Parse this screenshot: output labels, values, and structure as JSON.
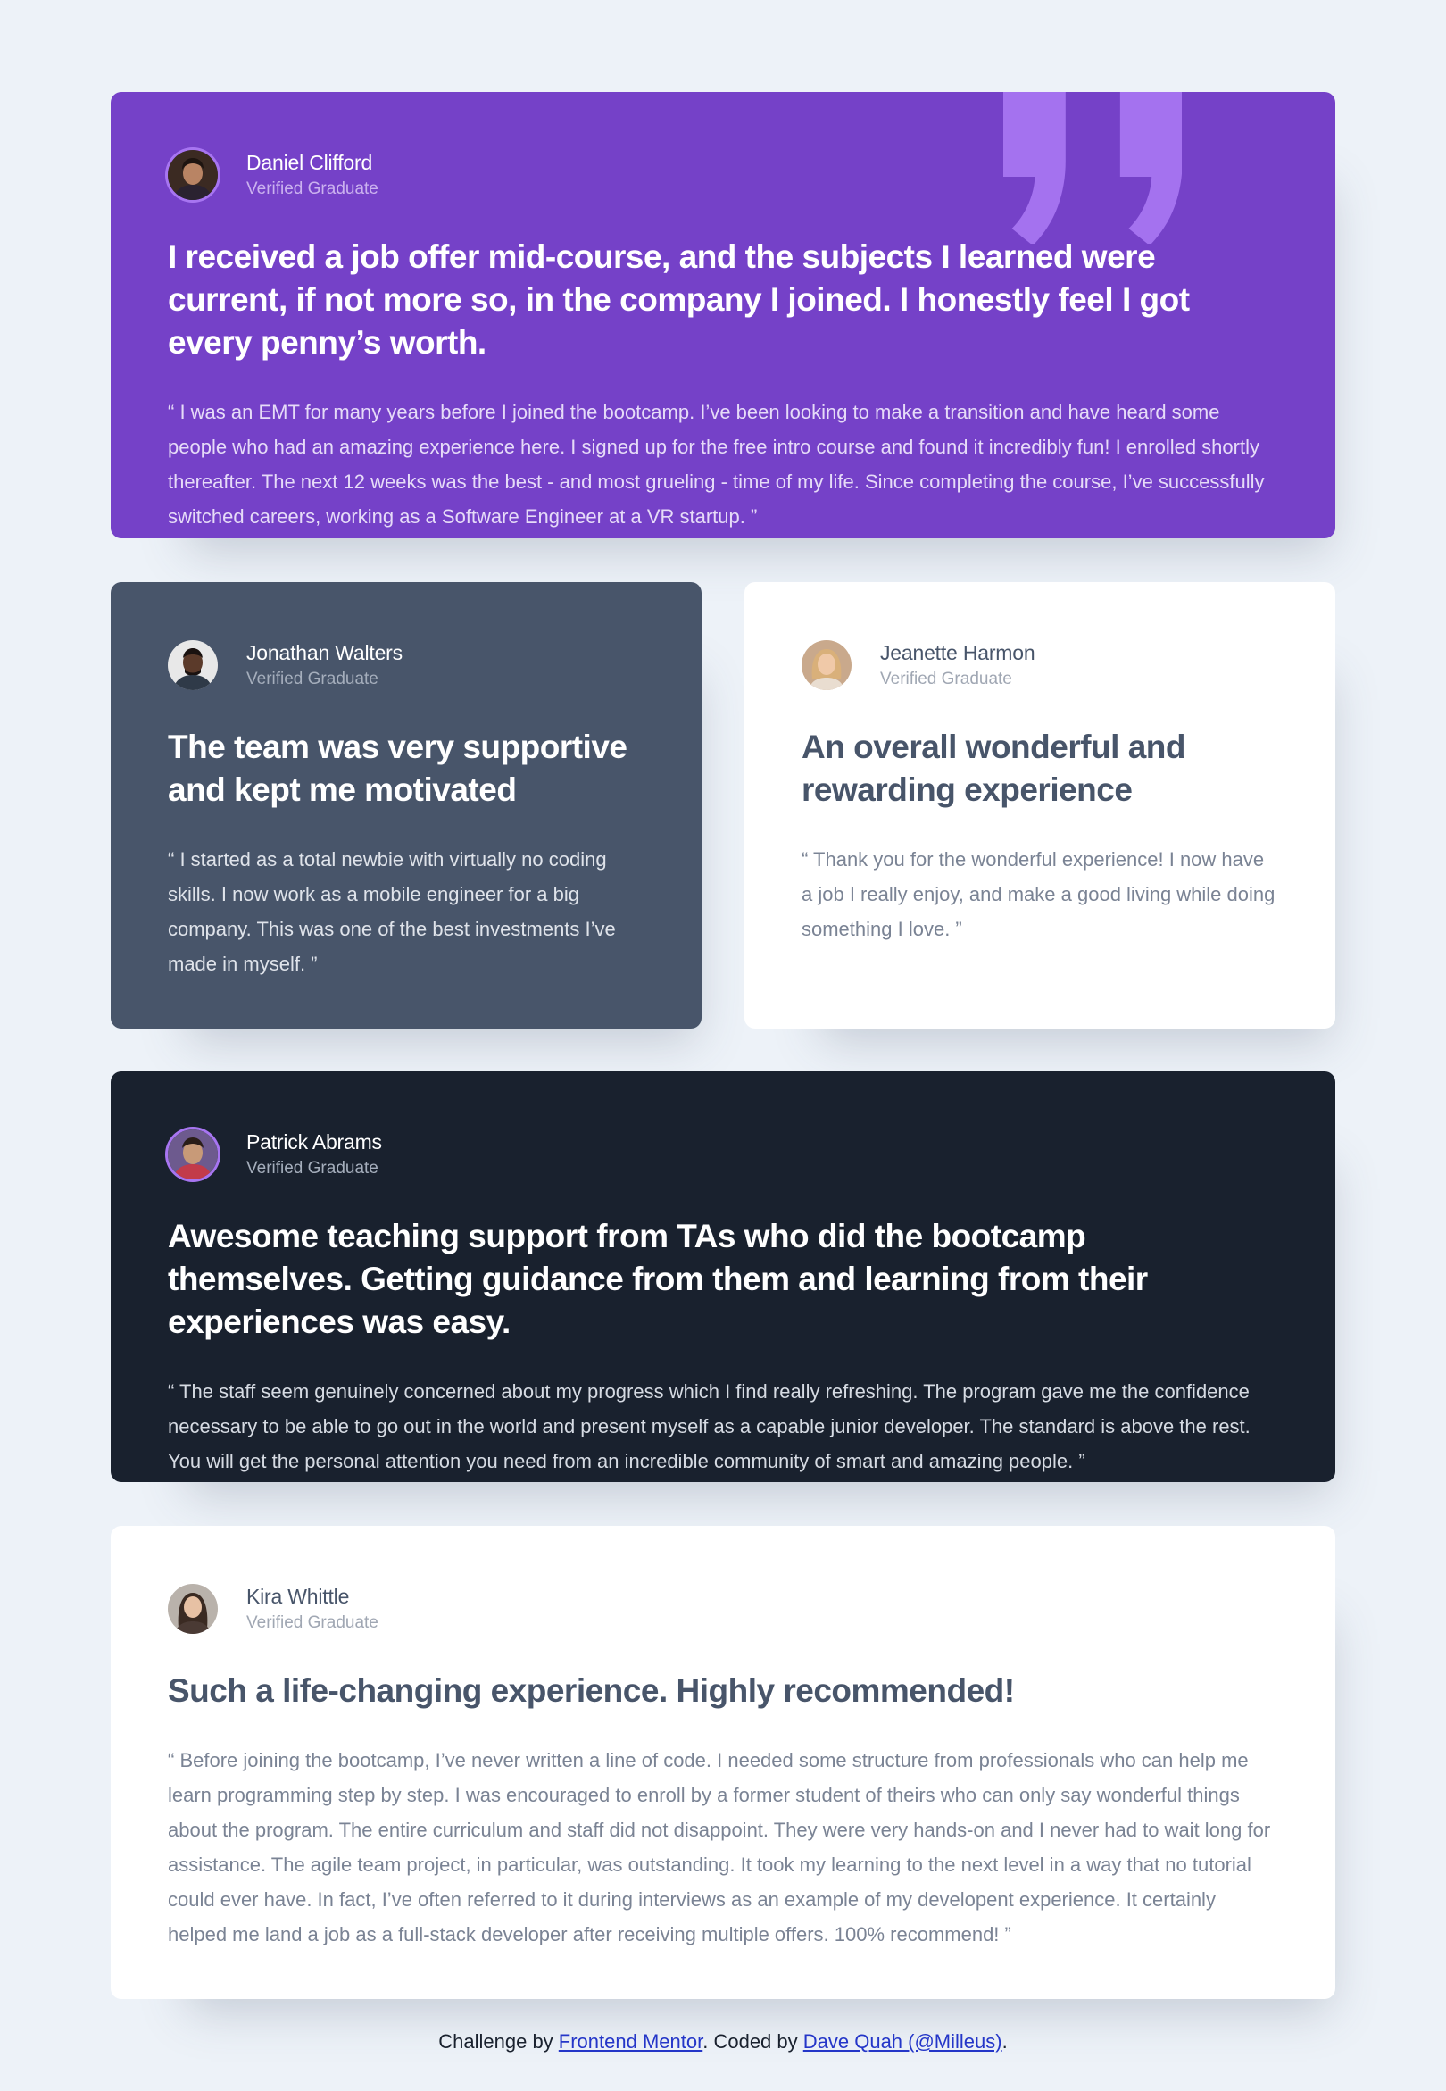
{
  "testimonials": {
    "daniel": {
      "name": "Daniel Clifford",
      "role": "Verified Graduate",
      "headline": "I received a job offer mid-course, and the subjects I learned were current, if not more so, in the company I joined. I honestly feel I got every penny’s worth.",
      "quote": "“ I was an EMT for many years before I joined the bootcamp. I’ve been looking to make a transition and have heard some people who had an amazing experience here. I signed up for the free intro course and found it incredibly fun! I enrolled shortly thereafter. The next 12 weeks was the best - and most grueling - time of my life. Since completing the course, I’ve successfully switched careers, working as a Software Engineer at a VR startup. ”"
    },
    "jonathan": {
      "name": "Jonathan Walters",
      "role": "Verified Graduate",
      "headline": "The team was very supportive and kept me motivated",
      "quote": "“ I started as a total newbie with virtually no coding skills. I now work as a mobile engineer for a big company. This was one of the best investments I’ve made in myself. ”"
    },
    "jeanette": {
      "name": "Jeanette Harmon",
      "role": "Verified Graduate",
      "headline": "An overall wonderful and rewarding experience",
      "quote": "“ Thank you for the wonderful experience! I now have a job I really enjoy, and make a good living while doing something I love. ”"
    },
    "patrick": {
      "name": "Patrick Abrams",
      "role": "Verified Graduate",
      "headline": "Awesome teaching support from TAs who did the bootcamp themselves. Getting guidance from them and learning from their experiences was easy.",
      "quote": "“ The staff seem genuinely concerned about my progress which I find really refreshing. The program gave me the confidence necessary to be able to go out in the world and present myself as a capable junior developer. The standard is above the rest. You will get the personal attention you need from an incredible community of smart and amazing people. ”"
    },
    "kira": {
      "name": "Kira Whittle",
      "role": "Verified Graduate",
      "headline": "Such a life-changing experience. Highly recommended!",
      "quote": "“ Before joining the bootcamp, I’ve never written a line of code. I needed some structure from professionals who can help me learn programming step by step. I was encouraged to enroll by a former student of theirs who can only say wonderful things about the program. The entire curriculum and staff did not disappoint. They were very hands-on and I never had to wait long for assistance. The agile team project, in particular, was outstanding. It took my learning to the next level in a way that no tutorial could ever have. In fact, I’ve often referred to it during interviews as an example of my developent experience. It certainly helped me land a job as a full-stack developer after receiving multiple offers. 100% recommend! ”"
    }
  },
  "footer": {
    "prefix": "Challenge by ",
    "mentor_link": "Frontend Mentor",
    "middle": ". Coded by ",
    "author_link": "Dave Quah (@Milleus)",
    "suffix": "."
  },
  "colors": {
    "purple": "#7541c8",
    "gray": "#48556a",
    "white": "#ffffff",
    "dark": "#19212e",
    "background": "#edf2f8",
    "quote_mark": "#a775f1"
  },
  "icons": {
    "quote": "bg-pattern-quotation"
  }
}
